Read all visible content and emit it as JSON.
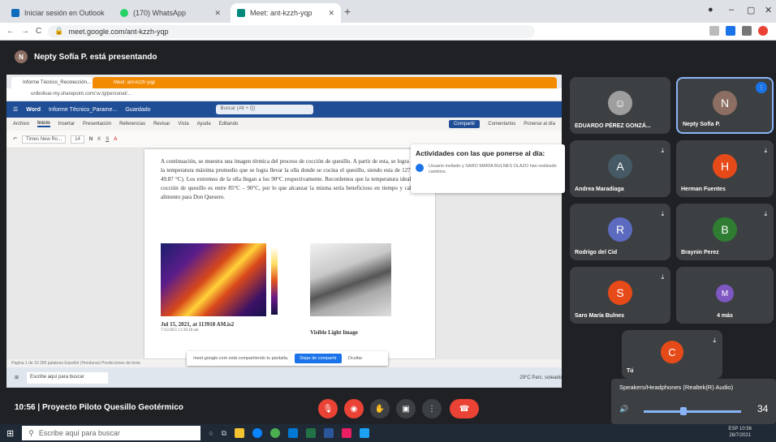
{
  "browser": {
    "tabs": [
      {
        "label": "Iniciar sesión en Outlook",
        "color": "#0f6cbd"
      },
      {
        "label": "(170) WhatsApp",
        "color": "#25d366"
      },
      {
        "label": "Meet: ant-kzzh-yqp",
        "color": "#00897b",
        "active": true
      }
    ],
    "url": "meet.google.com/ant-kzzh-yqp"
  },
  "presenter": {
    "initial": "N",
    "text": "Nepty Sofía P. está presentando",
    "color": "#8d6e63"
  },
  "shared": {
    "tab1": "Informe Técnico_Recolección...",
    "tab2": "Meet: ant-kzzh-yqp",
    "address": "unibolivar-my.sharepoint.com/:w:/g/personal/...",
    "word_title": "Informe Técnico_Parame...",
    "saved": "Guardado",
    "search_placeholder": "Buscar (Alt + Q)",
    "menu": [
      "Archivo",
      "Inicio",
      "Insertar",
      "Presentación",
      "Referencias",
      "Revisar",
      "Vista",
      "Ayuda",
      "Editando"
    ],
    "share_btn": "Compartir",
    "comments_btn": "Comentarios",
    "catchup_btn": "Ponerse al día",
    "font": "Times New Ro...",
    "size": "14",
    "doc_text": "A continuación, se muestra una imagen térmica del proceso de cocción de quesillo. A partir de esta, se logra conocer la temperatura máxima promedio que se logra llevar la olla donde se cocina el quesillo, siendo esta de 127.4 °F (o 49.87 °C). Los extremos de la olla llegan a los 90°C respectivamente. Recordemos que la temperatura ideal para la cocción de quesillo es entre 85°C – 90°C, por lo que alcanzar la misma sería beneficioso en tiempo y calidad de alimento para Don Quesero.",
    "caption1": "Jul 15, 2021, at 113918 AM.is2",
    "caption1_sub": "7/15/2021 11:39:18 am",
    "caption2": "Visible Light Image",
    "notif_title": "Actividades con las que ponerse al día:",
    "notif_body": "Usuario invitado y SARO MARÍA BULNES OLAZO han realizado cambios.",
    "share_banner": "meet.google.com está compartiendo tu pantalla.",
    "stop_btn": "Dejar de compartir",
    "hide_btn": "Ocultar",
    "status": "Página 1 de 10   395 palabras   Español (Honduras)   Predicciones de texto",
    "inner_search": "Escribe aquí para buscar",
    "inner_weather": "29°C  Parc. soleado"
  },
  "participants": [
    {
      "name": "EDUARDO PÉREZ GONZÁ...",
      "initial": "",
      "photo": true,
      "color": "#9e9e9e"
    },
    {
      "name": "Nepty Sofía P.",
      "initial": "N",
      "color": "#8d6e63"
    },
    {
      "name": "Andrea Maradiaga",
      "initial": "A",
      "color": "#455a64"
    },
    {
      "name": "Herman Fuentes",
      "initial": "H",
      "color": "#e64a19"
    },
    {
      "name": "Rodrigo del Cid",
      "initial": "R",
      "color": "#5c6bc0"
    },
    {
      "name": "Braynin Perez",
      "initial": "B",
      "color": "#2e7d32"
    },
    {
      "name": "Saro María Bulnes",
      "initial": "S",
      "color": "#e64a19"
    },
    {
      "name": "4 más",
      "initial": "M",
      "color": "#7e57c2"
    },
    {
      "name": "Tú",
      "initial": "C",
      "color": "#e64a19"
    }
  ],
  "meeting": {
    "time": "10:56",
    "title": "Proyecto Piloto Quesillo Geotérmico"
  },
  "audio": {
    "device": "Speakers/Headphones (Realtek(R) Audio)",
    "volume": "34"
  },
  "taskbar": {
    "search": "Escribe aquí para buscar",
    "lang": "ESP",
    "time": "10:56",
    "date": "26/7/2021"
  },
  "colors": {
    "accent": "#1a73e8",
    "end_call": "#ea4335"
  }
}
